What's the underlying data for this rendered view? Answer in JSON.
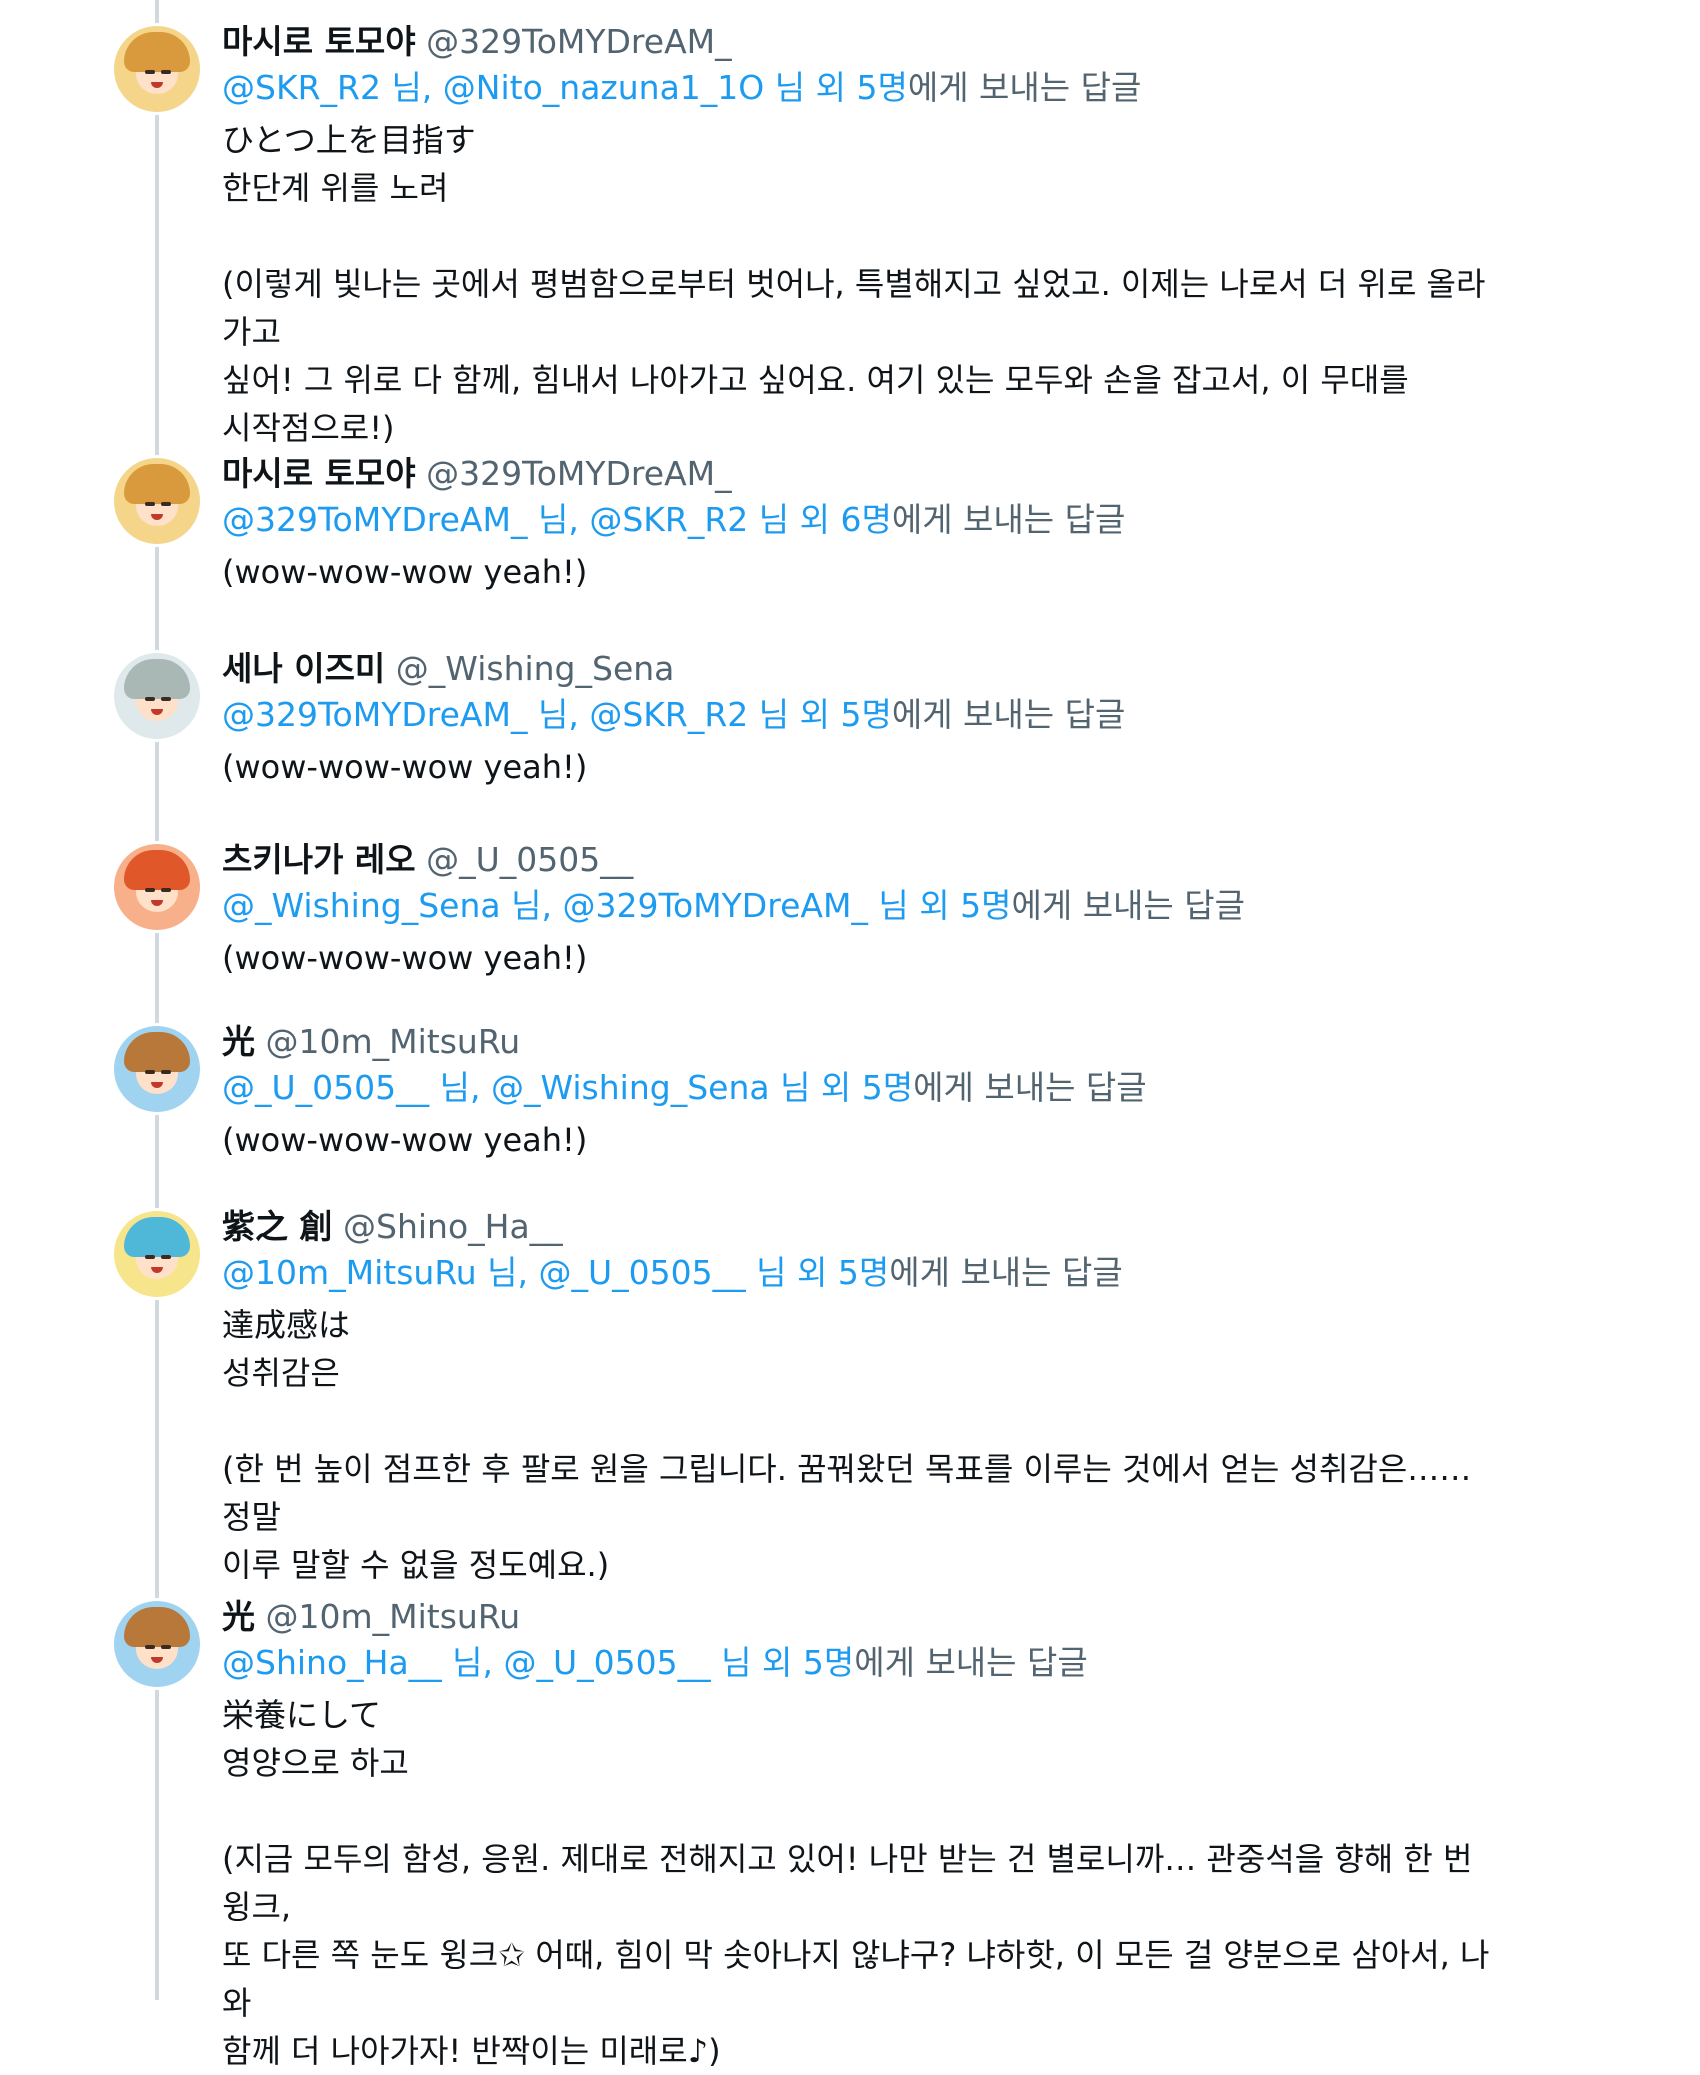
{
  "reply_suffix": "에게 보내는 답글",
  "tweets": [
    {
      "display_name": "마시로 토모야",
      "handle": "@329ToMYDreAM_",
      "reply_to": {
        "first": "@SKR_R2",
        "sep1": " 님, ",
        "second": "@Nito_nazuna1_1O",
        "sep2": " 님 외 ",
        "count": "5명"
      },
      "text": "ひとつ上を目指す\n한단계 위를 노려\n\n(이렇게 빛나는 곳에서 평범함으로부터 벗어나, 특별해지고 싶었고. 이제는 나로서 더 위로 올라가고\n싶어! 그 위로 다 함께, 힘내서 나아가고 싶어요. 여기 있는 모두와 손을 잡고서, 이 무대를\n시작점으로!)",
      "avatar": {
        "hair": "#d89a3c",
        "bg": "#f4d58a",
        "icon": "tomoya-avatar-icon"
      }
    },
    {
      "display_name": "마시로 토모야",
      "handle": "@329ToMYDreAM_",
      "reply_to": {
        "first": "@329ToMYDreAM_",
        "sep1": " 님, ",
        "second": "@SKR_R2",
        "sep2": " 님 외 ",
        "count": "6명"
      },
      "text": "(wow-wow-wow yeah!)",
      "avatar": {
        "hair": "#d89a3c",
        "bg": "#f4d58a",
        "icon": "tomoya-avatar-icon"
      }
    },
    {
      "display_name": "세나 이즈미",
      "handle": "@_Wishing_Sena",
      "reply_to": {
        "first": "@329ToMYDreAM_",
        "sep1": " 님, ",
        "second": "@SKR_R2",
        "sep2": " 님 외 ",
        "count": "5명"
      },
      "text": "(wow-wow-wow yeah!)",
      "avatar": {
        "hair": "#a9b8b5",
        "bg": "#dfe8ea",
        "icon": "izumi-avatar-icon"
      }
    },
    {
      "display_name": "츠키나가 레오",
      "handle": "@_U_0505__",
      "reply_to": {
        "first": "@_Wishing_Sena",
        "sep1": " 님, ",
        "second": "@329ToMYDreAM_",
        "sep2": " 님 외 ",
        "count": "5명"
      },
      "text": "(wow-wow-wow yeah!)",
      "avatar": {
        "hair": "#e0572a",
        "bg": "#f7b08a",
        "icon": "leo-avatar-icon"
      }
    },
    {
      "display_name": "光",
      "handle": "@10m_MitsuRu",
      "reply_to": {
        "first": "@_U_0505__",
        "sep1": " 님, ",
        "second": "@_Wishing_Sena",
        "sep2": " 님 외 ",
        "count": "5명"
      },
      "text": "(wow-wow-wow yeah!)",
      "avatar": {
        "hair": "#b8783a",
        "bg": "#9fd3f0",
        "icon": "mitsuru-avatar-icon"
      }
    },
    {
      "display_name": "紫之 創",
      "handle": "@Shino_Ha__",
      "reply_to": {
        "first": "@10m_MitsuRu",
        "sep1": " 님, ",
        "second": "@_U_0505__",
        "sep2": " 님 외 ",
        "count": "5명"
      },
      "text": "達成感は\n성취감은\n\n(한 번 높이 점프한 후 팔로 원을 그립니다. 꿈꿔왔던 목표를 이루는 것에서 얻는 성취감은……정말\n이루 말할 수 없을 정도예요.)",
      "avatar": {
        "hair": "#4fb8d8",
        "bg": "#f6e58a",
        "icon": "hajime-avatar-icon"
      }
    },
    {
      "display_name": "光",
      "handle": "@10m_MitsuRu",
      "reply_to": {
        "first": "@Shino_Ha__",
        "sep1": " 님, ",
        "second": "@_U_0505__",
        "sep2": " 님 외 ",
        "count": "5명"
      },
      "text": "栄養にして\n영양으로 하고\n\n(지금 모두의 함성, 응원. 제대로 전해지고 있어! 나만 받는 건 별로니까… 관중석을 향해 한 번 윙크,\n또 다른 쪽 눈도 윙크✩ 어때, 힘이 막 솟아나지 않냐구? 냐하핫, 이 모든 걸 양분으로 삼아서, 나와\n함께 더 나아가자! 반짝이는 미래로♪)",
      "avatar": {
        "hair": "#b8783a",
        "bg": "#9fd3f0",
        "icon": "mitsuru-avatar-icon"
      }
    }
  ]
}
